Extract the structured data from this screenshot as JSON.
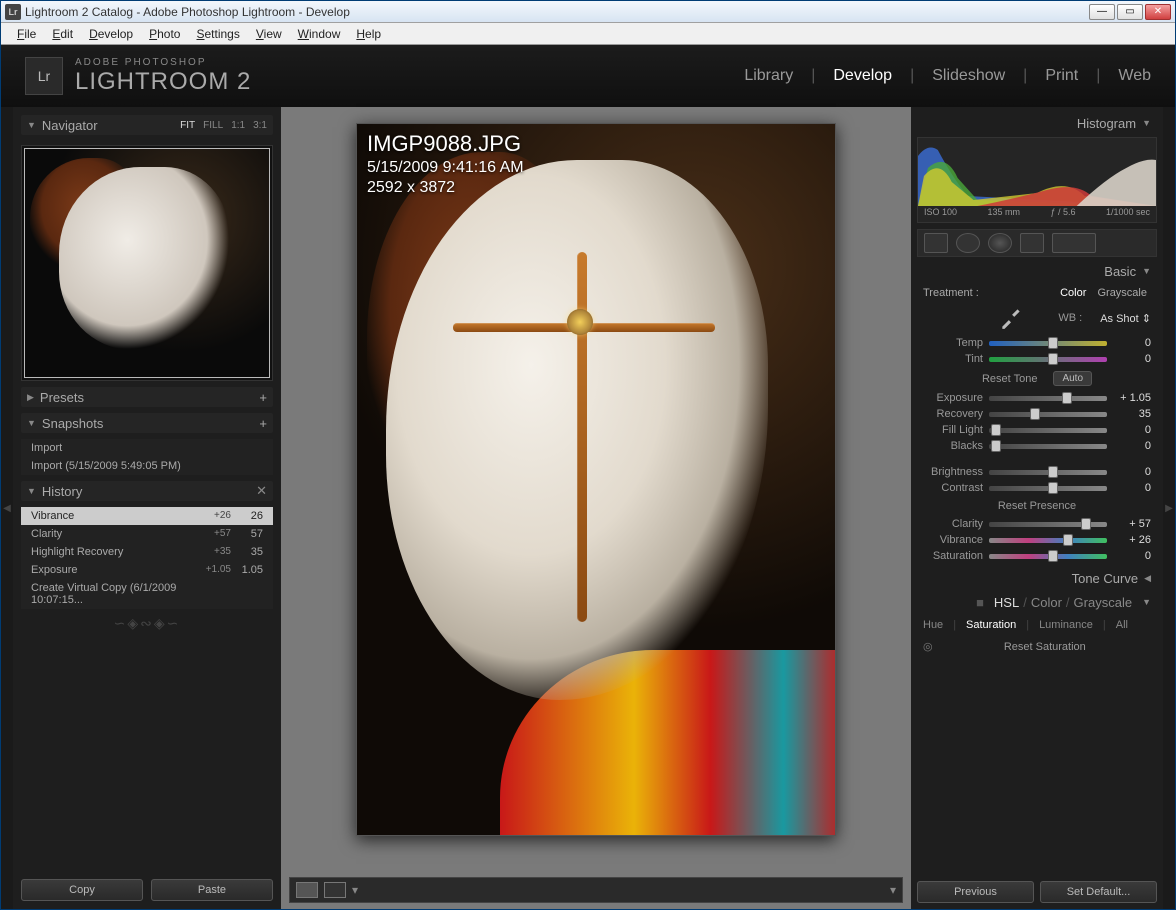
{
  "window": {
    "title": "Lightroom 2 Catalog - Adobe Photoshop Lightroom - Develop"
  },
  "menu": [
    "File",
    "Edit",
    "Develop",
    "Photo",
    "Settings",
    "View",
    "Window",
    "Help"
  ],
  "branding": {
    "top": "ADOBE PHOTOSHOP",
    "main": "LIGHTROOM 2",
    "badge": "Lr"
  },
  "modules": [
    "Library",
    "Develop",
    "Slideshow",
    "Print",
    "Web"
  ],
  "active_module": "Develop",
  "navigator": {
    "title": "Navigator",
    "zoom_modes": [
      "FIT",
      "FILL",
      "1:1",
      "3:1"
    ],
    "active_zoom": "FIT"
  },
  "presets": {
    "title": "Presets"
  },
  "snapshots": {
    "title": "Snapshots",
    "items": [
      "Import",
      "Import (5/15/2009 5:49:05 PM)"
    ]
  },
  "history": {
    "title": "History",
    "items": [
      {
        "name": "Vibrance",
        "delta": "+26",
        "value": "26",
        "selected": true
      },
      {
        "name": "Clarity",
        "delta": "+57",
        "value": "57"
      },
      {
        "name": "Highlight Recovery",
        "delta": "+35",
        "value": "35"
      },
      {
        "name": "Exposure",
        "delta": "+1.05",
        "value": "1.05"
      },
      {
        "name": "Create Virtual Copy (6/1/2009 10:07:15...",
        "delta": "",
        "value": ""
      }
    ]
  },
  "left_buttons": {
    "copy": "Copy",
    "paste": "Paste"
  },
  "image_overlay": {
    "filename": "IMGP9088.JPG",
    "datetime": "5/15/2009 9:41:16 AM",
    "dimensions": "2592 x 3872"
  },
  "histogram": {
    "title": "Histogram",
    "iso": "ISO 100",
    "focal": "135 mm",
    "aperture": "ƒ / 5.6",
    "shutter": "1/1000 sec"
  },
  "basic": {
    "title": "Basic",
    "treatment_label": "Treatment :",
    "treatment_options": [
      "Color",
      "Grayscale"
    ],
    "treatment_active": "Color",
    "wb_label": "WB :",
    "wb_value": "As Shot",
    "sliders_wb": [
      {
        "label": "Temp",
        "value": "0",
        "pos": 50,
        "cls": "temp"
      },
      {
        "label": "Tint",
        "value": "0",
        "pos": 50,
        "cls": "tint"
      }
    ],
    "tone_label": "Reset Tone",
    "auto_label": "Auto",
    "sliders_tone": [
      {
        "label": "Exposure",
        "value": "+ 1.05",
        "pos": 62
      },
      {
        "label": "Recovery",
        "value": "35",
        "pos": 35
      },
      {
        "label": "Fill Light",
        "value": "0",
        "pos": 2
      },
      {
        "label": "Blacks",
        "value": "0",
        "pos": 2
      }
    ],
    "sliders_bc": [
      {
        "label": "Brightness",
        "value": "0",
        "pos": 50
      },
      {
        "label": "Contrast",
        "value": "0",
        "pos": 50
      }
    ],
    "presence_label": "Reset Presence",
    "sliders_presence": [
      {
        "label": "Clarity",
        "value": "+ 57",
        "pos": 78
      },
      {
        "label": "Vibrance",
        "value": "+ 26",
        "pos": 63,
        "cls": "vib"
      },
      {
        "label": "Saturation",
        "value": "0",
        "pos": 50,
        "cls": "vib"
      }
    ]
  },
  "tone_curve": {
    "title": "Tone Curve"
  },
  "hsl": {
    "title_parts": [
      "HSL",
      "Color",
      "Grayscale"
    ],
    "tabs": [
      "Hue",
      "Saturation",
      "Luminance",
      "All"
    ],
    "active_tab": "Saturation",
    "reset_label": "Reset Saturation"
  },
  "right_buttons": {
    "prev": "Previous",
    "setdef": "Set Default..."
  }
}
